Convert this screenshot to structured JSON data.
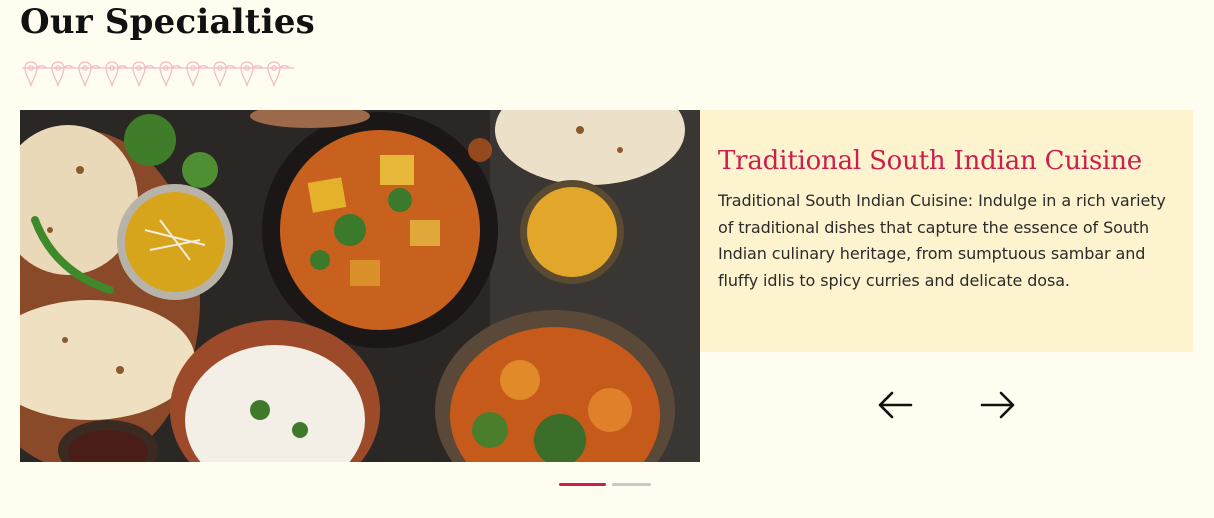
{
  "section": {
    "title": "Our Specialties"
  },
  "slide": {
    "image_description": "top-down view of Indian dishes: paneer curry, rice, naan, dal, turmeric, vegetable curry",
    "heading": "Traditional South Indian Cuisine",
    "text": "Traditional South Indian Cuisine: Indulge in a rich variety of traditional dishes that capture the essence of South Indian culinary heritage, from sumptuous sambar and fluffy idlis to spicy curries and delicate dosa."
  },
  "controls": {
    "prev_icon": "arrow-left-icon",
    "next_icon": "arrow-right-icon"
  },
  "pagination": {
    "total": 2,
    "active_index": 0
  },
  "colors": {
    "background": "#fefdef",
    "card_background": "#fdf3cf",
    "accent": "#cc1f4f",
    "ornament": "#f1b9c6"
  }
}
